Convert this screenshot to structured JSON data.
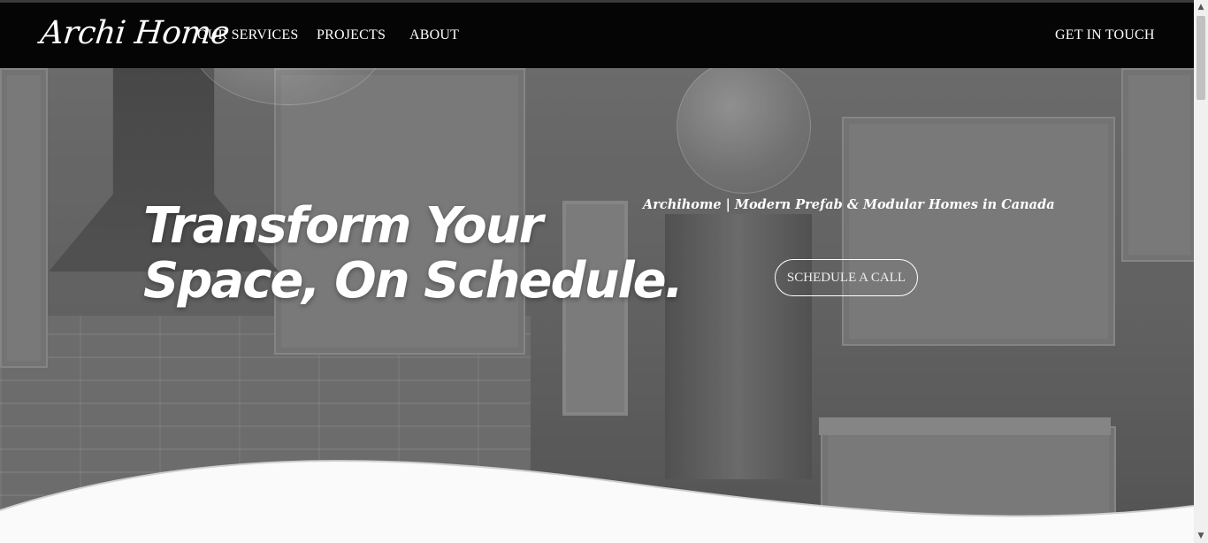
{
  "nav": {
    "logo": "Archi Home",
    "links": [
      "OUR SERVICES",
      "PROJECTS",
      "ABOUT"
    ],
    "contact": "GET IN TOUCH"
  },
  "hero": {
    "headline_line1": "Transform Your",
    "headline_line2": "Space, On Schedule.",
    "tagline": "Archihome | Modern Prefab & Modular Homes in Canada",
    "cta": "SCHEDULE A CALL"
  },
  "scrollbar": {
    "up": "▲",
    "down": "▼"
  }
}
